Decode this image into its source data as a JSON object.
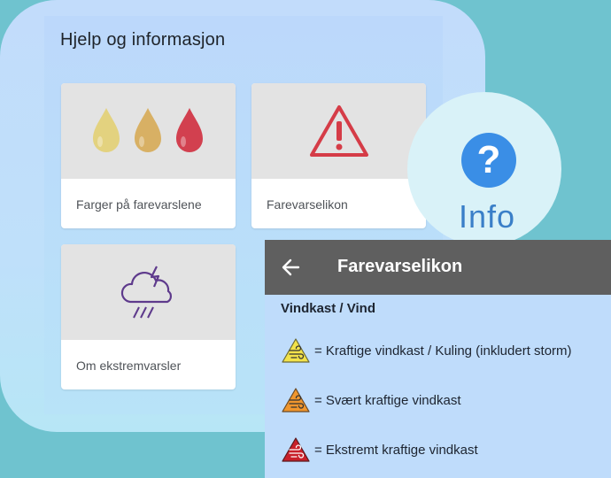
{
  "help": {
    "title": "Hjelp og informasjon",
    "cards": [
      {
        "label": "Farger på farevarslene",
        "icon": "drops-icon"
      },
      {
        "label": "Farevarselikon",
        "icon": "warning-triangle-icon"
      },
      {
        "label": "Om ekstremvarsler",
        "icon": "storm-cloud-icon"
      }
    ]
  },
  "info_badge": {
    "symbol": "?",
    "label": "Info"
  },
  "detail": {
    "title": "Farevarselikon",
    "section": "Vindkast / Vind",
    "warnings": [
      {
        "level": "yellow",
        "color": "#f2e24a",
        "text": "= Kraftige vindkast / Kuling (inkludert storm)"
      },
      {
        "level": "orange",
        "color": "#f0962d",
        "text": "= Svært kraftige vindkast"
      },
      {
        "level": "red",
        "color": "#c8202a",
        "text": "= Ekstremt kraftige vindkast"
      }
    ]
  },
  "colors": {
    "drop_yellow": "#e3d27f",
    "drop_gold": "#d8b064",
    "drop_red": "#d2404f",
    "triangle_red": "#d53c47",
    "storm_purple": "#5e3a8c"
  }
}
